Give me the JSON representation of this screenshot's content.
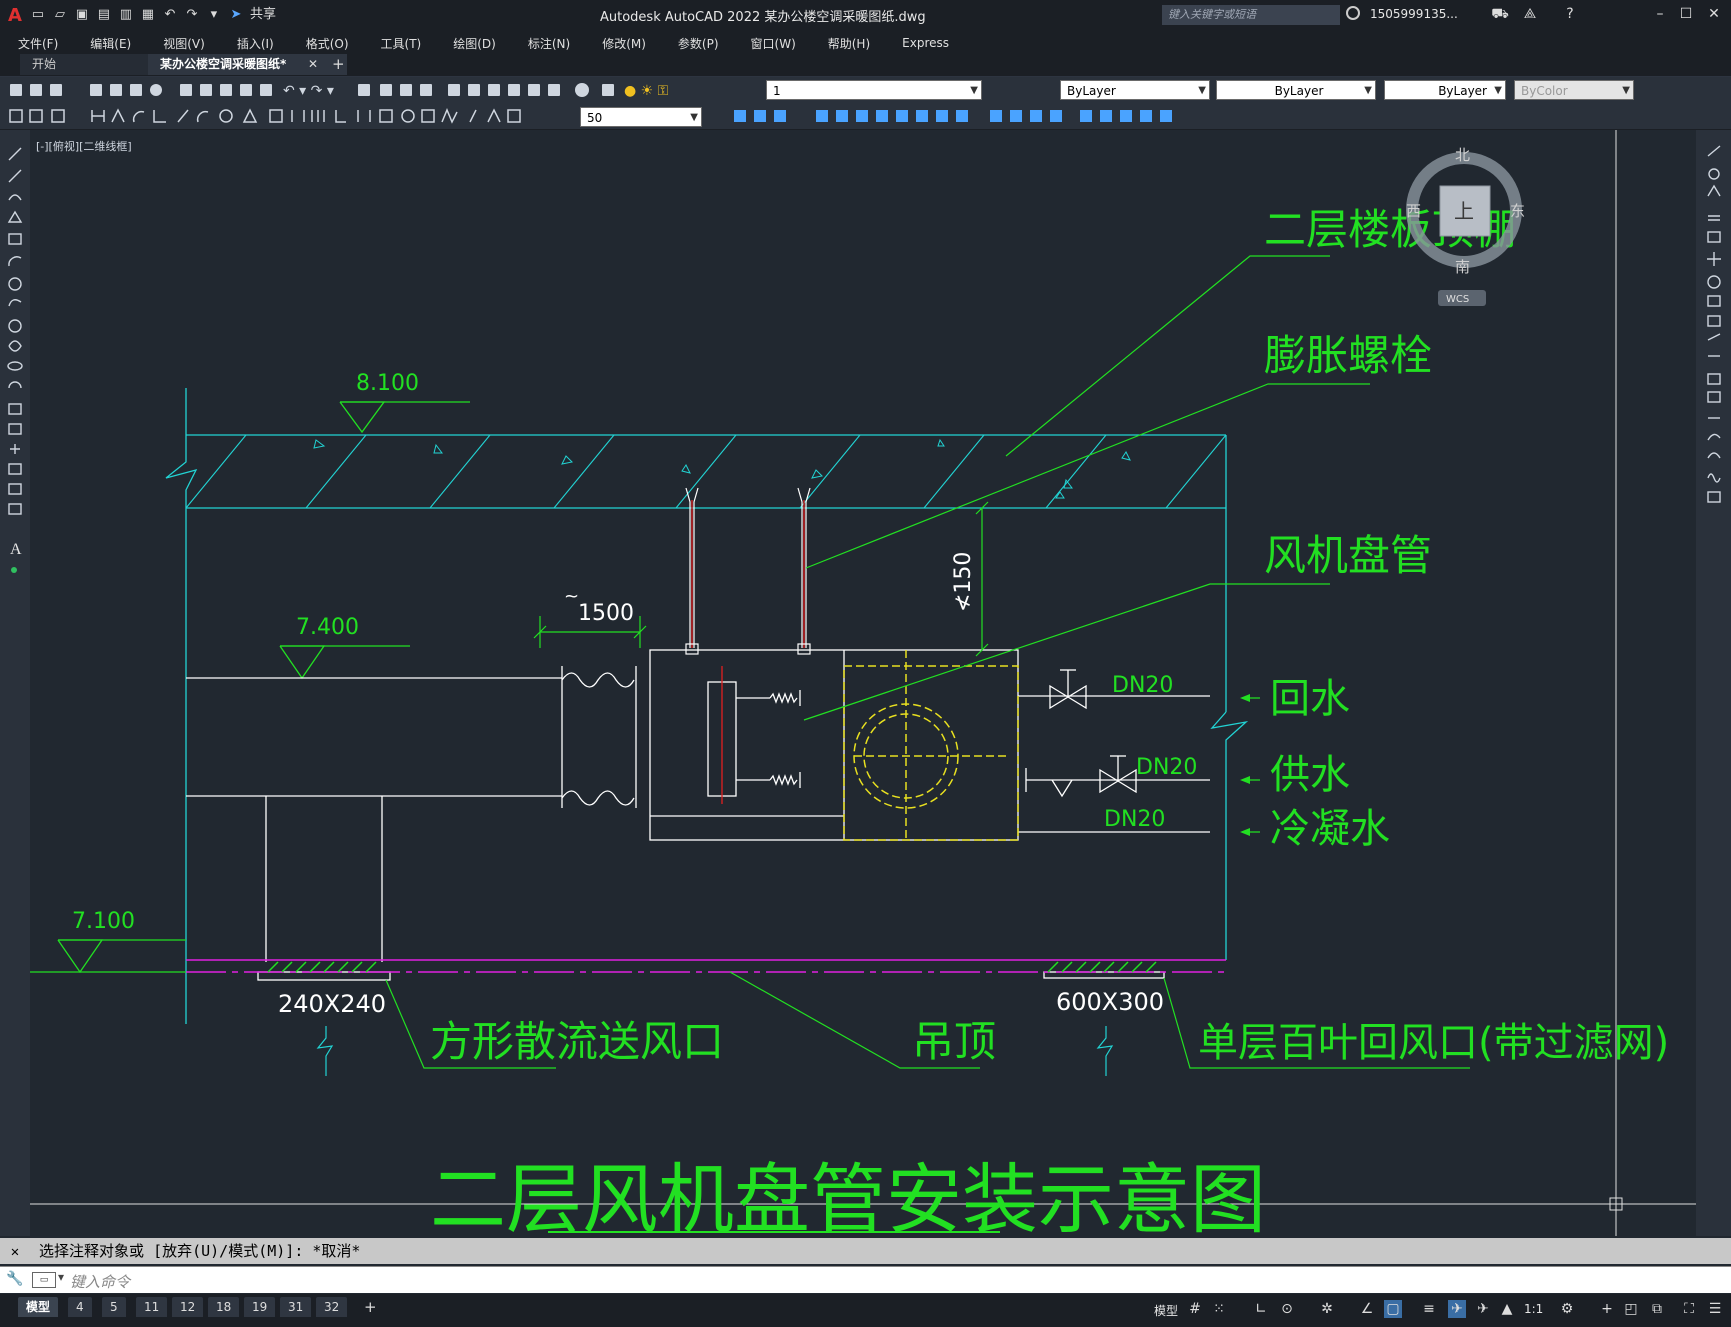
{
  "app": {
    "title": "Autodesk AutoCAD 2022    某办公楼空调采暖图纸.dwg",
    "logo": "A",
    "search_placeholder": "键入关键字或短语",
    "user": "1505999135...",
    "share_label": "共享"
  },
  "menubar": [
    "文件(F)",
    "编辑(E)",
    "视图(V)",
    "插入(I)",
    "格式(O)",
    "工具(T)",
    "绘图(D)",
    "标注(N)",
    "修改(M)",
    "参数(P)",
    "窗口(W)",
    "帮助(H)",
    "Express"
  ],
  "tabs": [
    {
      "label": "开始",
      "active": false
    },
    {
      "label": "某办公楼空调采暖图纸*",
      "active": true
    }
  ],
  "toolbar": {
    "layer_value": "1",
    "color_value": "ByLayer",
    "linetype_value": "ByLayer",
    "lineweight_value": "ByLayer",
    "plotstyle_value": "ByColor",
    "scale_value": "50"
  },
  "viewport_label": "[-][俯视][二维线框]",
  "viewcube": {
    "north": "北",
    "south": "南",
    "east": "东",
    "west": "西",
    "top_face": "上",
    "wcs": "WCS"
  },
  "drawing": {
    "labels": {
      "ceiling_slab": "二层楼板顶棚",
      "expansion_bolt": "膨胀螺栓",
      "fan_coil": "风机盘管",
      "return_water": "回水",
      "supply_water": "供水",
      "condensate": "冷凝水",
      "supply_diffuser": "方形散流送风口",
      "suspended_ceiling": "吊顶",
      "return_grille": "单层百叶回风口(带过滤网)",
      "main_title": "二层风机盘管安装示意图"
    },
    "elevations": {
      "top": "8.100",
      "mid": "7.400",
      "low": "7.100"
    },
    "dims": {
      "duct_len": "1500",
      "duct_tilde": "~",
      "clearance": "≮150",
      "diffuser_size": "240X240",
      "grille_size": "600X300"
    },
    "pipe_sizes": {
      "return": "DN20",
      "supply": "DN20",
      "condensate": "DN20"
    }
  },
  "command": {
    "history": "选择注释对象或 [放弃(U)/模式(M)]: *取消*",
    "input_placeholder": "键入命令"
  },
  "layout_tabs": [
    "模型",
    "4",
    "5",
    "11",
    "12",
    "18",
    "19",
    "31",
    "32",
    "+"
  ],
  "status": {
    "model_label": "模型",
    "scale": "1:1"
  },
  "colors": {
    "canvas": "#212830",
    "green": "#22e022",
    "cyan": "#22d3d3",
    "magenta": "#e020e0",
    "yellow": "#e8e020",
    "white": "#ffffff",
    "red": "#e02020"
  }
}
